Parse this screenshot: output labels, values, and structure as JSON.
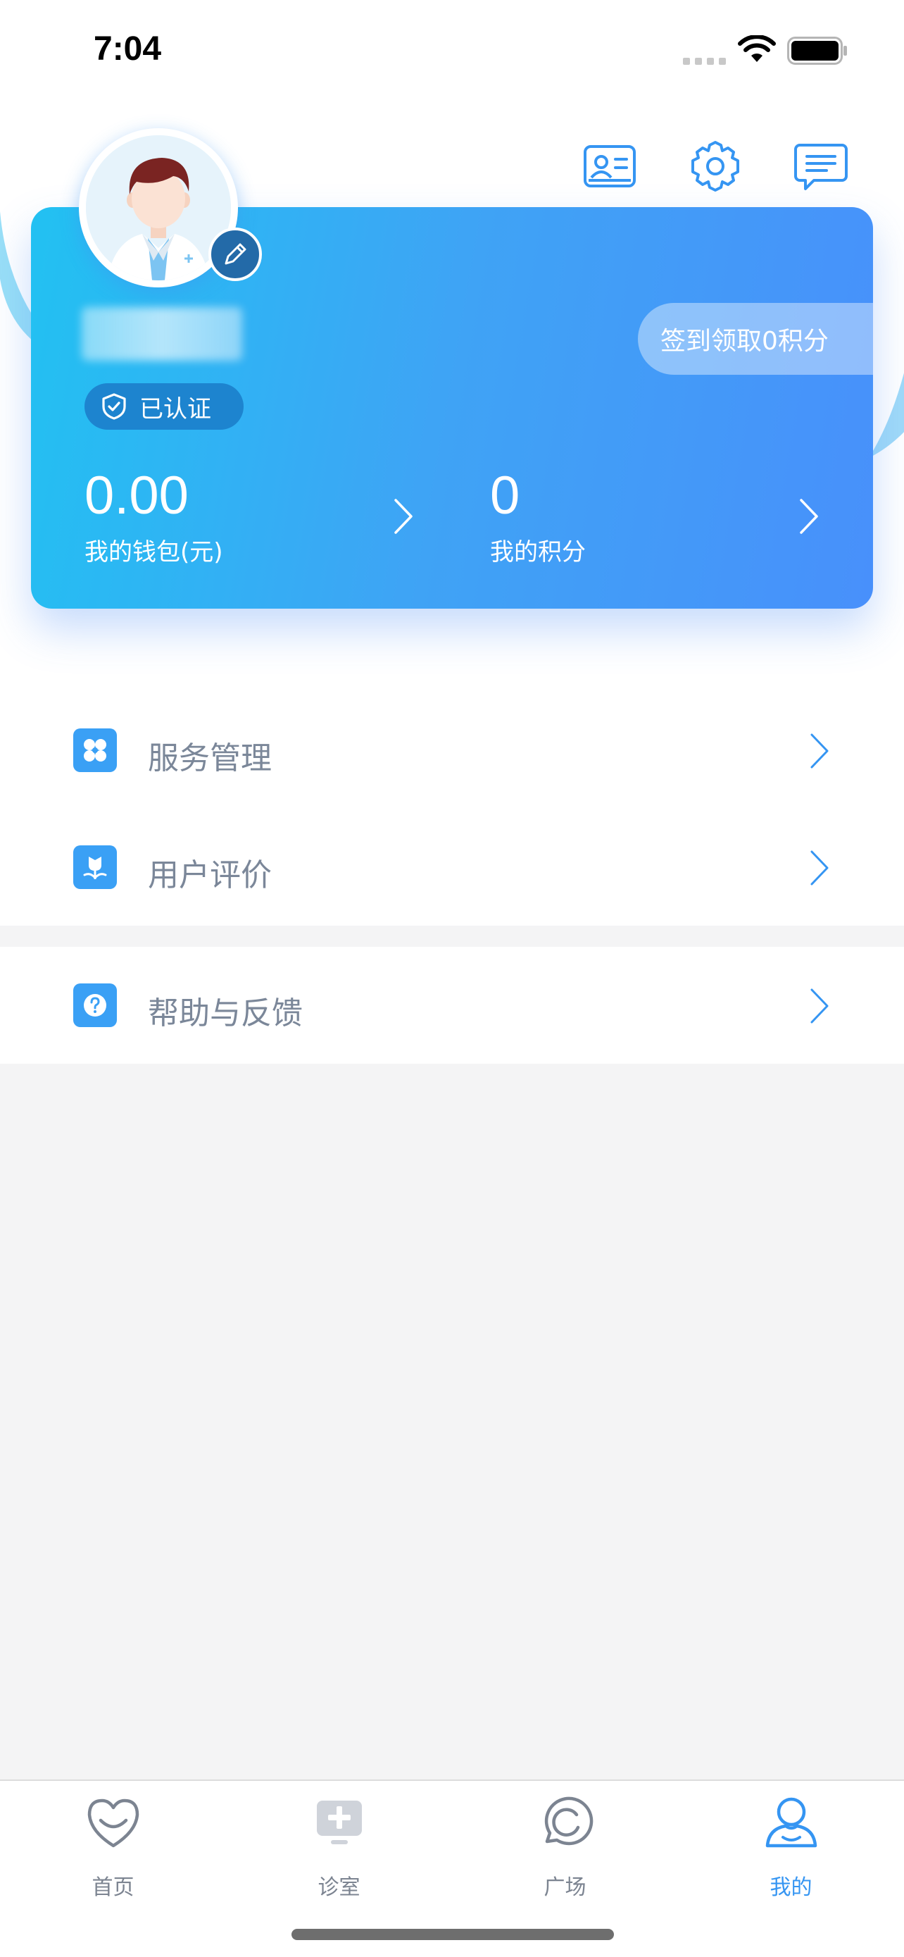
{
  "status_bar": {
    "time": "7:04"
  },
  "profile": {
    "verified_label": "已认证",
    "checkin_label": "签到领取0积分",
    "wallet": {
      "value": "0.00",
      "label": "我的钱包(元)"
    },
    "points": {
      "value": "0",
      "label": "我的积分"
    }
  },
  "menu": {
    "items": [
      {
        "label": "服务管理",
        "icon": "grid-icon"
      },
      {
        "label": "用户评价",
        "icon": "flower-icon"
      },
      {
        "label": "帮助与反馈",
        "icon": "help-icon"
      }
    ]
  },
  "tabbar": {
    "active_index": 3,
    "tabs": [
      {
        "label": "首页",
        "icon": "heart-home-icon"
      },
      {
        "label": "诊室",
        "icon": "clinic-plus-icon"
      },
      {
        "label": "广场",
        "icon": "square-chat-icon"
      },
      {
        "label": "我的",
        "icon": "person-icon"
      }
    ]
  },
  "colors": {
    "accent": "#3595f2",
    "card_gradient_start": "#22c1f2",
    "card_gradient_end": "#4890fb",
    "menu_text": "#7b8799",
    "page_background": "#f4f4f5"
  }
}
